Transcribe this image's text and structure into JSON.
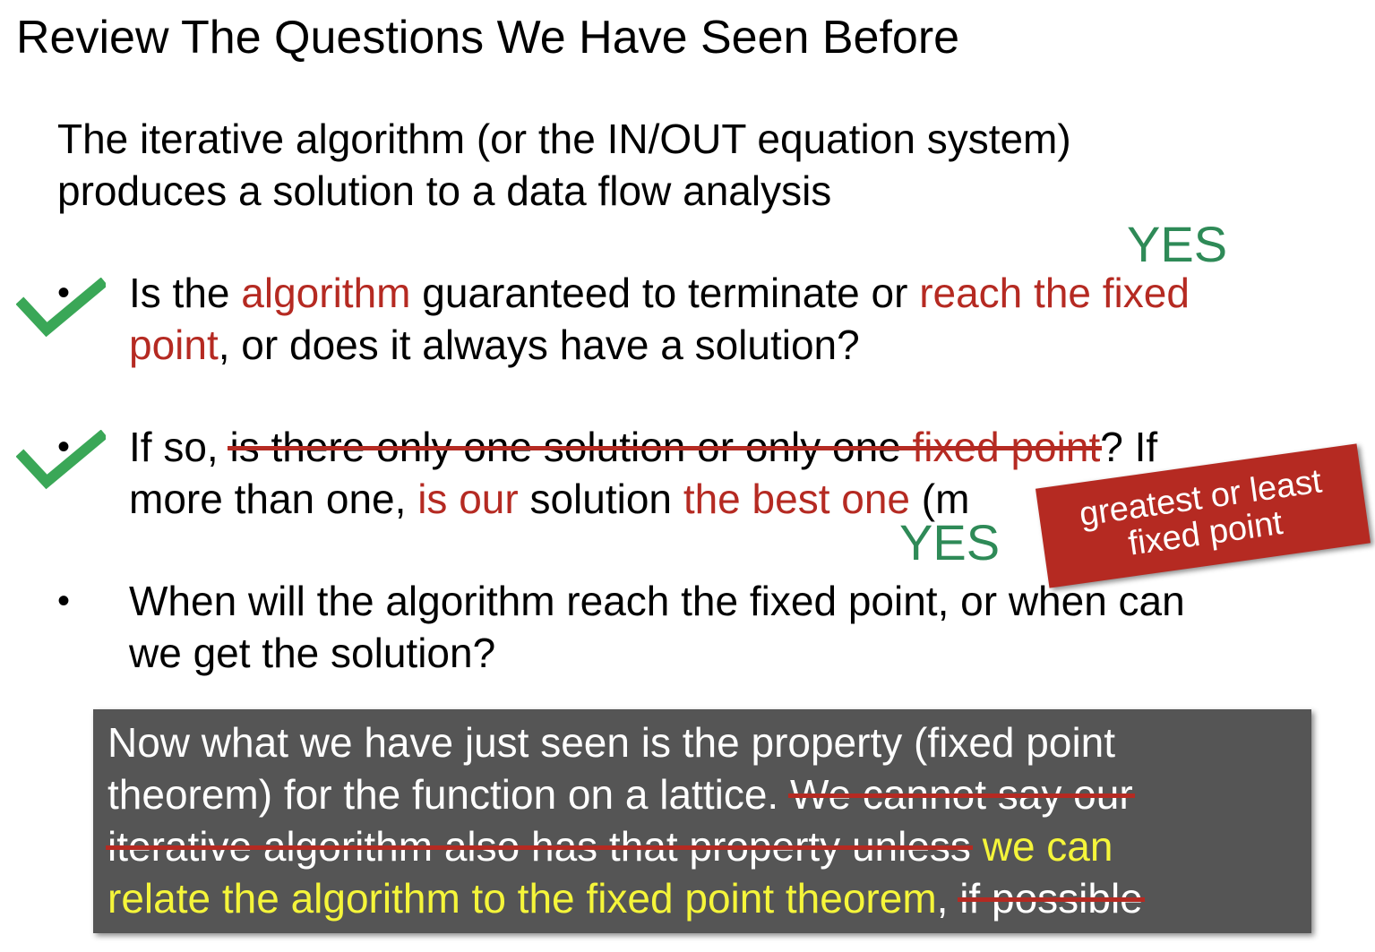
{
  "title": "Review The Questions We Have Seen Before",
  "intro": {
    "line1": "The iterative algorithm (or the IN/OUT equation system)",
    "line2": "produces a solution to a data flow analysis"
  },
  "bullet_marker": "•",
  "q1": {
    "answer": "YES",
    "l1_a": "Is the ",
    "l1_b": "algorithm",
    "l1_c": " guaranteed to terminate or ",
    "l1_d": "reach the fixed",
    "l2_a": "point",
    "l2_b": ", or does it always have a solution?"
  },
  "q2": {
    "answer": "YES",
    "l1_a": "If so, ",
    "l1_b": "is there only one solution or only one ",
    "l1_c": "fixed point",
    "l1_d": "? If",
    "l2_a": "more than one, ",
    "l2_b": "is our",
    "l2_c": " solution ",
    "l2_d": "the best one",
    "l2_e": " (m"
  },
  "q3": {
    "l1": "When will the algorithm reach the fixed point, or when can",
    "l2": "we get the solution?"
  },
  "stamp": {
    "line1": "greatest or least",
    "line2": "fixed point"
  },
  "note": {
    "l1": "Now what we have just seen is the property (fixed point",
    "l2_a": "theorem) for the function on a lattice. ",
    "l2_b": "We cannot say our",
    "l3_a": "iterative algorithm also has that property unless",
    "l3_b": " we can",
    "l4_a": "relate the algorithm to the fixed point theorem",
    "l4_b": ", ",
    "l4_c": "if possible"
  },
  "colors": {
    "accent_red": "#b52a22",
    "answer_green": "#2e8a57",
    "check_green": "#3aa757",
    "highlight_yellow": "#f5f53a",
    "note_background": "#555555"
  },
  "icons": [
    "checkmark-icon",
    "checkmark-icon"
  ]
}
